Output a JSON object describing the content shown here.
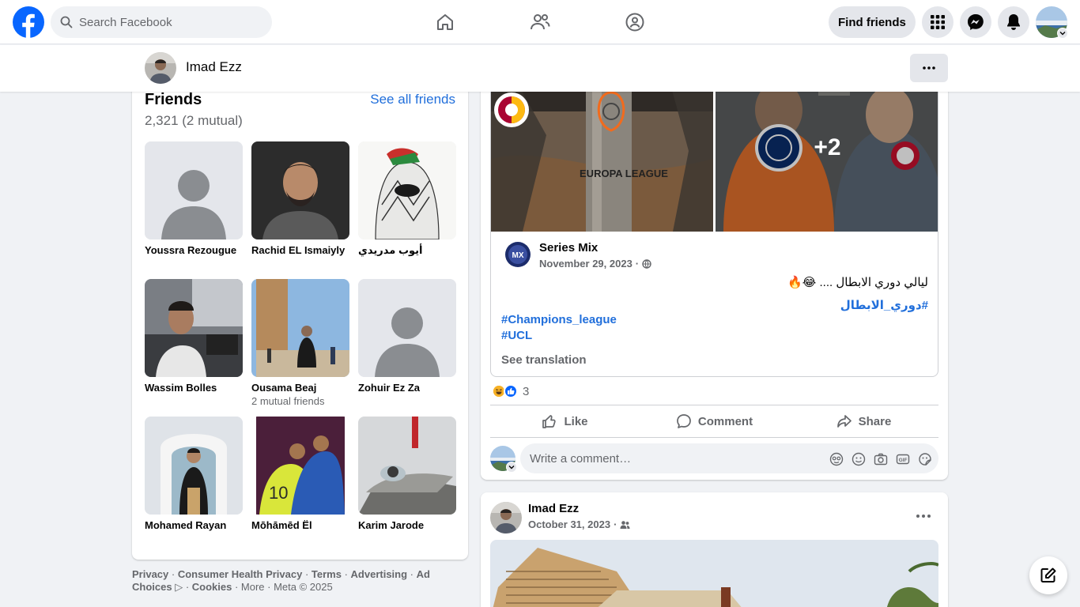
{
  "topbar": {
    "search_placeholder": "Search Facebook",
    "find_friends_label": "Find friends",
    "nav_icons": [
      "home-icon",
      "friends-icon",
      "groups-icon"
    ],
    "right_icons": [
      "menu-grid-icon",
      "messenger-icon",
      "bell-icon"
    ]
  },
  "sticky": {
    "profile_name": "Imad Ezz",
    "more_icon": "ellipsis-icon"
  },
  "friends": {
    "title": "Friends",
    "see_all": "See all friends",
    "count": "2,321 (2 mutual)",
    "items": [
      {
        "name": "Youssra Rezougue",
        "mutual": ""
      },
      {
        "name": "Rachid EL Ismaiyly",
        "mutual": ""
      },
      {
        "name": "أيوب مدريدي",
        "mutual": ""
      },
      {
        "name": "Wassim Bolles",
        "mutual": ""
      },
      {
        "name": "Ousama Beaj",
        "mutual": "2 mutual friends"
      },
      {
        "name": "Zohuir Ez Za",
        "mutual": ""
      },
      {
        "name": "Mohamed Rayan",
        "mutual": ""
      },
      {
        "name": "Mōhāmēd Ël",
        "mutual": ""
      },
      {
        "name": "Karim Jarode",
        "mutual": ""
      }
    ]
  },
  "footer": {
    "links": [
      "Privacy",
      "Consumer Health Privacy",
      "Terms",
      "Advertising",
      "Ad Choices",
      "Cookies"
    ],
    "more": "More",
    "copyright": "Meta © 2025"
  },
  "post1": {
    "image_overlay_count": "+2",
    "image_text": "EUROPA LEAGUE",
    "page_name": "Series Mix",
    "date": "November 29, 2023",
    "text_ar": "ليالي دوري الابطال .... 😂🔥",
    "hashtag_ar": "#دوري_الابطال",
    "hashtags": [
      "#Champions_league",
      "#UCL"
    ],
    "see_translation": "See translation",
    "reaction_count": "3",
    "actions": {
      "like": "Like",
      "comment": "Comment",
      "share": "Share"
    },
    "comment_placeholder": "Write a comment…"
  },
  "post2": {
    "author": "Imad Ezz",
    "date": "October 31, 2023"
  },
  "colors": {
    "brand": "#0866ff",
    "link": "#216fdb",
    "secondary_text": "#65676b",
    "surface": "#ffffff",
    "background": "#f0f2f5"
  }
}
